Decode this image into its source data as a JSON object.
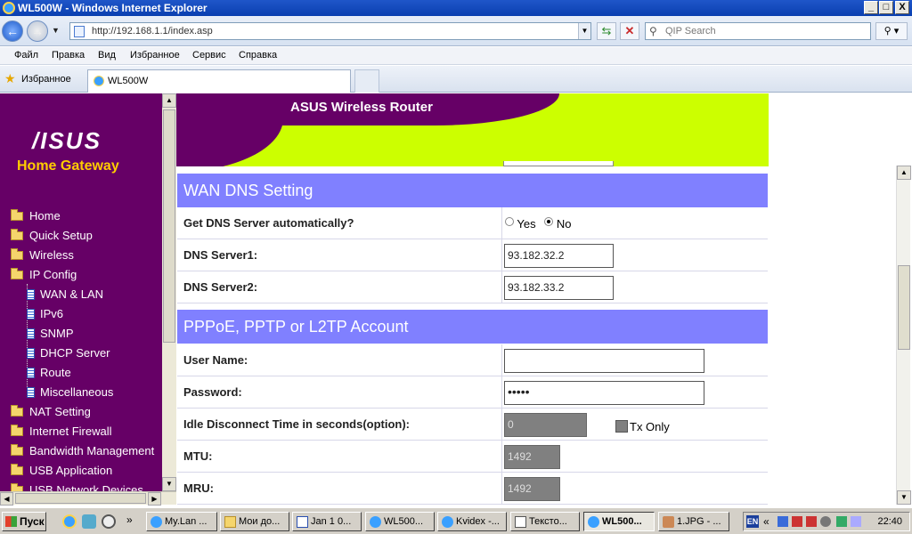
{
  "window": {
    "title": "WL500W - Windows Internet Explorer",
    "controls": [
      "_",
      "□",
      "X"
    ]
  },
  "browser": {
    "address": "http://192.168.1.1/index.asp",
    "search_placeholder": "QIP Search",
    "menu": [
      "Файл",
      "Правка",
      "Вид",
      "Избранное",
      "Сервис",
      "Справка"
    ],
    "favorites_label": "Избранное",
    "tab_title": "WL500W"
  },
  "sidebar": {
    "logo": "/ISUS",
    "subtitle": "Home Gateway",
    "items": [
      {
        "label": "Home"
      },
      {
        "label": "Quick Setup"
      },
      {
        "label": "Wireless"
      },
      {
        "label": "IP Config"
      },
      {
        "label": "WAN & LAN"
      },
      {
        "label": "IPv6"
      },
      {
        "label": "SNMP"
      },
      {
        "label": "DHCP Server"
      },
      {
        "label": "Route"
      },
      {
        "label": "Miscellaneous"
      },
      {
        "label": "NAT Setting"
      },
      {
        "label": "Internet Firewall"
      },
      {
        "label": "Bandwidth Management"
      },
      {
        "label": "USB Application"
      },
      {
        "label": "USB Network Devices"
      }
    ]
  },
  "banner": {
    "title": "ASUS Wireless Router"
  },
  "form": {
    "wan_dns": {
      "header": "WAN DNS Setting",
      "auto_label": "Get DNS Server automatically?",
      "yes_label": "Yes",
      "no_label": "No",
      "auto_selected": "No",
      "dns1_label": "DNS Server1:",
      "dns1_value": "93.182.32.2",
      "dns2_label": "DNS Server2:",
      "dns2_value": "93.182.33.2"
    },
    "pppoe": {
      "header": "PPPoE, PPTP or L2TP Account",
      "username_label": "User Name:",
      "username_value": "",
      "password_label": "Password:",
      "password_value": "•••••",
      "idle_label": "Idle Disconnect Time in seconds(option):",
      "idle_value": "0",
      "tx_only_label": "Tx Only",
      "mtu_label": "MTU:",
      "mtu_value": "1492",
      "mru_label": "MRU:",
      "mru_value": "1492"
    }
  },
  "taskbar": {
    "start_label": "Пуск",
    "quicklaunch_more": "»",
    "buttons": [
      {
        "label": "My.Lan ..."
      },
      {
        "label": "Мои до..."
      },
      {
        "label": "Jan 1 0..."
      },
      {
        "label": "WL500..."
      },
      {
        "label": "Kvidex -..."
      },
      {
        "label": "Тексто..."
      },
      {
        "label": "WL500...",
        "active": true
      },
      {
        "label": "1.JPG - ..."
      }
    ],
    "lang": "EN",
    "tray_more": "«",
    "clock": "22:40"
  }
}
